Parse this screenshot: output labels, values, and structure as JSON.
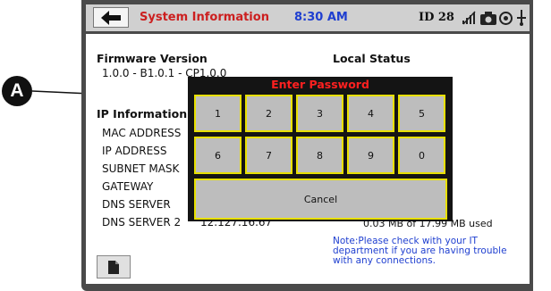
{
  "header": {
    "title": "System Information",
    "time": "8:30 AM",
    "id_label": "ID 28",
    "icons": [
      "back-arrow-icon",
      "wifi-off-icon",
      "camera-icon",
      "gear-icon",
      "usb-icon"
    ]
  },
  "firmware": {
    "label": "Firmware Version",
    "value": "1.0.0 - B1.0.1 - CP1.0.0"
  },
  "local_status": {
    "label": "Local Status"
  },
  "ip": {
    "heading": "IP Information",
    "rows": [
      "MAC ADDRESS",
      "IP ADDRESS",
      "SUBNET MASK",
      "GATEWAY",
      "DNS SERVER",
      "DNS SERVER 2"
    ],
    "dns2_value": "12.127.16.67"
  },
  "storage": "0.03 MB of 17.99 MB used",
  "note": "Note:Please check with your IT department if you are having trouble with any connections.",
  "password_dialog": {
    "title": "Enter Password",
    "keys_row1": [
      "1",
      "2",
      "3",
      "4",
      "5"
    ],
    "keys_row2": [
      "6",
      "7",
      "8",
      "9",
      "0"
    ],
    "cancel": "Cancel"
  },
  "callout": {
    "label": "A"
  },
  "colors": {
    "title_red": "#cc1f1f",
    "time_blue": "#1f3fd0",
    "key_border": "#e8e000",
    "dialog_bg": "#141414"
  }
}
